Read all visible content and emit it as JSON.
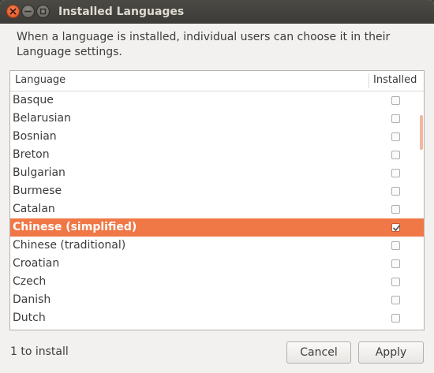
{
  "window": {
    "title": "Installed Languages"
  },
  "description": "When a language is installed, individual users can choose it in their Language settings.",
  "list": {
    "columns": {
      "language": "Language",
      "installed": "Installed"
    },
    "rows": [
      {
        "name": "Basque",
        "installed": false,
        "selected": false
      },
      {
        "name": "Belarusian",
        "installed": false,
        "selected": false
      },
      {
        "name": "Bosnian",
        "installed": false,
        "selected": false
      },
      {
        "name": "Breton",
        "installed": false,
        "selected": false
      },
      {
        "name": "Bulgarian",
        "installed": false,
        "selected": false
      },
      {
        "name": "Burmese",
        "installed": false,
        "selected": false
      },
      {
        "name": "Catalan",
        "installed": false,
        "selected": false
      },
      {
        "name": "Chinese (simplified)",
        "installed": true,
        "selected": true
      },
      {
        "name": "Chinese (traditional)",
        "installed": false,
        "selected": false
      },
      {
        "name": "Croatian",
        "installed": false,
        "selected": false
      },
      {
        "name": "Czech",
        "installed": false,
        "selected": false
      },
      {
        "name": "Danish",
        "installed": false,
        "selected": false
      },
      {
        "name": "Dutch",
        "installed": false,
        "selected": false
      }
    ]
  },
  "status": "1 to install",
  "buttons": {
    "cancel": "Cancel",
    "apply": "Apply"
  },
  "colors": {
    "selection": "#f07746",
    "titlebar": "#3c3b37",
    "close_button": "#e1521d"
  },
  "icons": {
    "close": "close-icon",
    "minimize": "minimize-icon",
    "maximize": "maximize-icon",
    "checkmark": "checkmark-icon"
  }
}
